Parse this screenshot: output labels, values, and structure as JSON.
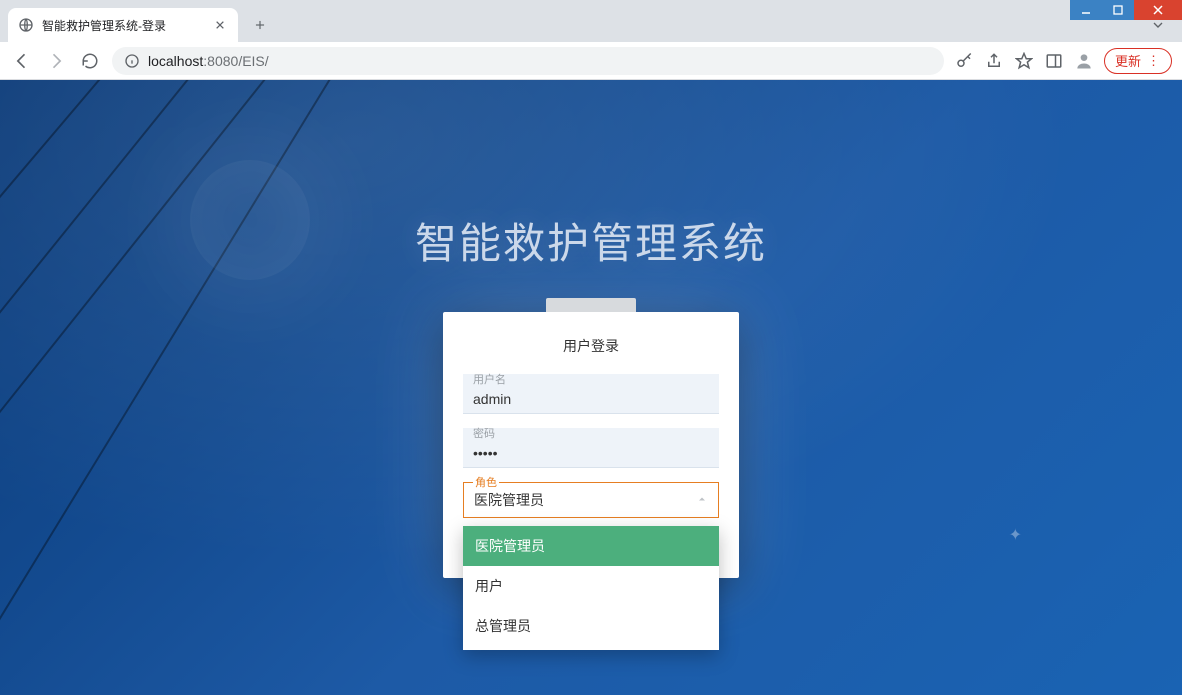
{
  "window": {
    "tab_title": "智能救护管理系统-登录"
  },
  "address": {
    "host": "localhost",
    "port": ":8080",
    "path": "/EIS/"
  },
  "toolbar": {
    "update_label": "更新"
  },
  "page": {
    "system_title": "智能救护管理系统",
    "login_title": "用户登录",
    "username_label": "用户名",
    "username_value": "admin",
    "password_label": "密码",
    "password_value": "•••••",
    "role_label": "角色",
    "role_selected": "医院管理员",
    "role_options": [
      "医院管理员",
      "用户",
      "总管理员"
    ]
  }
}
